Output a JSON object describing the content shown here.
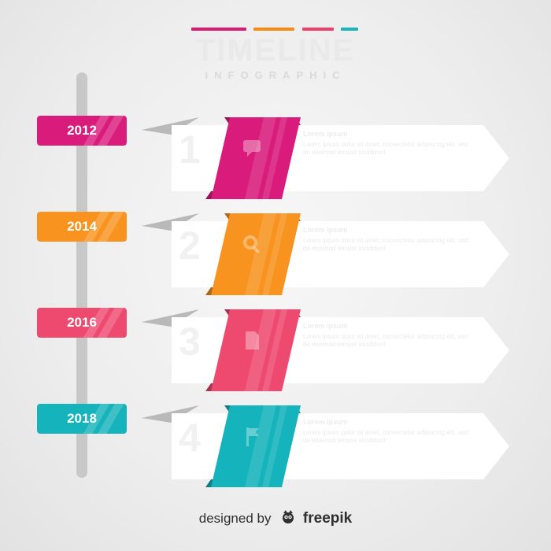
{
  "header": {
    "title": "TIMELINE",
    "subtitle": "INFOGRAPHIC",
    "accent_colors": [
      "#d81b72",
      "#f68c15",
      "#ee3f6b",
      "#1cb3bd"
    ]
  },
  "milestones": [
    {
      "year": "2012",
      "number": "1",
      "color": "#d91c7b",
      "icon": "chat-bubble-icon",
      "heading": "Lorem ipsum",
      "text": "Lorem ipsum dolor sit amet, consectetur adipiscing elit, sed do eiusmod tempor incididunt"
    },
    {
      "year": "2014",
      "number": "2",
      "color": "#f7931e",
      "icon": "magnifier-icon",
      "heading": "Lorem ipsum",
      "text": "Lorem ipsum dolor sit amet, consectetur adipiscing elit, sed do eiusmod tempor incididunt"
    },
    {
      "year": "2016",
      "number": "3",
      "color": "#ee4a6f",
      "icon": "document-icon",
      "heading": "Lorem ipsum",
      "text": "Lorem ipsum dolor sit amet, consectetur adipiscing elit, sed do eiusmod tempor incididunt"
    },
    {
      "year": "2018",
      "number": "4",
      "color": "#15b3bb",
      "icon": "flag-icon",
      "heading": "Lorem ipsum",
      "text": "Lorem ipsum dolor sit amet, consectetur adipiscing elit, sed do eiusmod tempor incididunt"
    }
  ],
  "footer": {
    "prefix": "designed by",
    "brand": "freepik",
    "icon": "freepik-logo-icon"
  }
}
